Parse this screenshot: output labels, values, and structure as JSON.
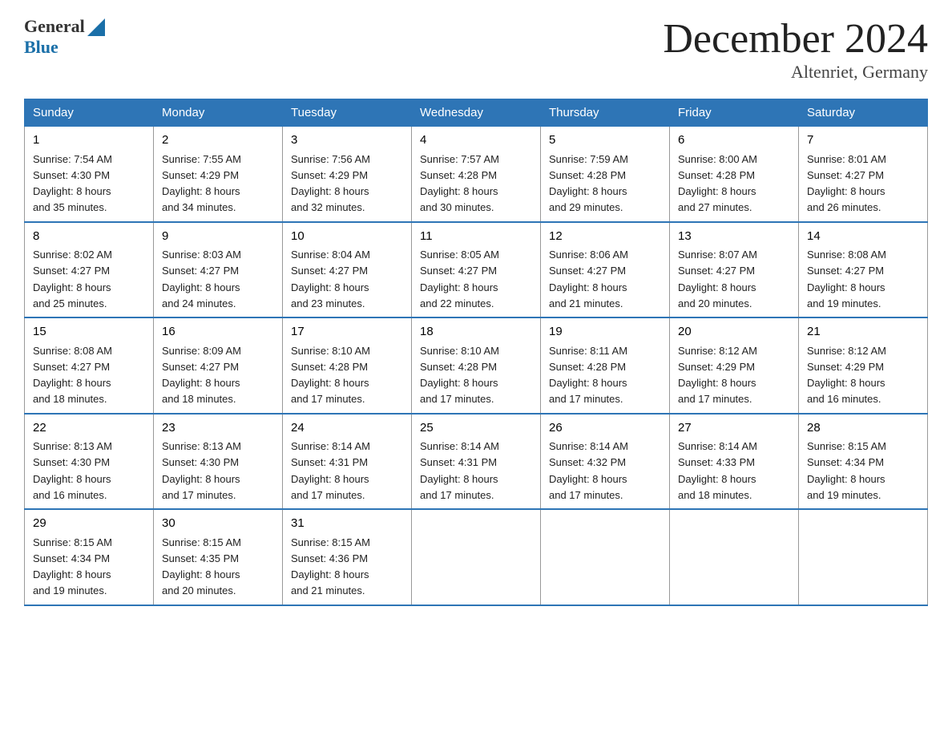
{
  "header": {
    "logo_general": "General",
    "logo_blue": "Blue",
    "month_title": "December 2024",
    "location": "Altenriet, Germany"
  },
  "weekdays": [
    "Sunday",
    "Monday",
    "Tuesday",
    "Wednesday",
    "Thursday",
    "Friday",
    "Saturday"
  ],
  "weeks": [
    [
      {
        "day": "1",
        "sunrise": "7:54 AM",
        "sunset": "4:30 PM",
        "daylight": "8 hours and 35 minutes."
      },
      {
        "day": "2",
        "sunrise": "7:55 AM",
        "sunset": "4:29 PM",
        "daylight": "8 hours and 34 minutes."
      },
      {
        "day": "3",
        "sunrise": "7:56 AM",
        "sunset": "4:29 PM",
        "daylight": "8 hours and 32 minutes."
      },
      {
        "day": "4",
        "sunrise": "7:57 AM",
        "sunset": "4:28 PM",
        "daylight": "8 hours and 30 minutes."
      },
      {
        "day": "5",
        "sunrise": "7:59 AM",
        "sunset": "4:28 PM",
        "daylight": "8 hours and 29 minutes."
      },
      {
        "day": "6",
        "sunrise": "8:00 AM",
        "sunset": "4:28 PM",
        "daylight": "8 hours and 27 minutes."
      },
      {
        "day": "7",
        "sunrise": "8:01 AM",
        "sunset": "4:27 PM",
        "daylight": "8 hours and 26 minutes."
      }
    ],
    [
      {
        "day": "8",
        "sunrise": "8:02 AM",
        "sunset": "4:27 PM",
        "daylight": "8 hours and 25 minutes."
      },
      {
        "day": "9",
        "sunrise": "8:03 AM",
        "sunset": "4:27 PM",
        "daylight": "8 hours and 24 minutes."
      },
      {
        "day": "10",
        "sunrise": "8:04 AM",
        "sunset": "4:27 PM",
        "daylight": "8 hours and 23 minutes."
      },
      {
        "day": "11",
        "sunrise": "8:05 AM",
        "sunset": "4:27 PM",
        "daylight": "8 hours and 22 minutes."
      },
      {
        "day": "12",
        "sunrise": "8:06 AM",
        "sunset": "4:27 PM",
        "daylight": "8 hours and 21 minutes."
      },
      {
        "day": "13",
        "sunrise": "8:07 AM",
        "sunset": "4:27 PM",
        "daylight": "8 hours and 20 minutes."
      },
      {
        "day": "14",
        "sunrise": "8:08 AM",
        "sunset": "4:27 PM",
        "daylight": "8 hours and 19 minutes."
      }
    ],
    [
      {
        "day": "15",
        "sunrise": "8:08 AM",
        "sunset": "4:27 PM",
        "daylight": "8 hours and 18 minutes."
      },
      {
        "day": "16",
        "sunrise": "8:09 AM",
        "sunset": "4:27 PM",
        "daylight": "8 hours and 18 minutes."
      },
      {
        "day": "17",
        "sunrise": "8:10 AM",
        "sunset": "4:28 PM",
        "daylight": "8 hours and 17 minutes."
      },
      {
        "day": "18",
        "sunrise": "8:10 AM",
        "sunset": "4:28 PM",
        "daylight": "8 hours and 17 minutes."
      },
      {
        "day": "19",
        "sunrise": "8:11 AM",
        "sunset": "4:28 PM",
        "daylight": "8 hours and 17 minutes."
      },
      {
        "day": "20",
        "sunrise": "8:12 AM",
        "sunset": "4:29 PM",
        "daylight": "8 hours and 17 minutes."
      },
      {
        "day": "21",
        "sunrise": "8:12 AM",
        "sunset": "4:29 PM",
        "daylight": "8 hours and 16 minutes."
      }
    ],
    [
      {
        "day": "22",
        "sunrise": "8:13 AM",
        "sunset": "4:30 PM",
        "daylight": "8 hours and 16 minutes."
      },
      {
        "day": "23",
        "sunrise": "8:13 AM",
        "sunset": "4:30 PM",
        "daylight": "8 hours and 17 minutes."
      },
      {
        "day": "24",
        "sunrise": "8:14 AM",
        "sunset": "4:31 PM",
        "daylight": "8 hours and 17 minutes."
      },
      {
        "day": "25",
        "sunrise": "8:14 AM",
        "sunset": "4:31 PM",
        "daylight": "8 hours and 17 minutes."
      },
      {
        "day": "26",
        "sunrise": "8:14 AM",
        "sunset": "4:32 PM",
        "daylight": "8 hours and 17 minutes."
      },
      {
        "day": "27",
        "sunrise": "8:14 AM",
        "sunset": "4:33 PM",
        "daylight": "8 hours and 18 minutes."
      },
      {
        "day": "28",
        "sunrise": "8:15 AM",
        "sunset": "4:34 PM",
        "daylight": "8 hours and 19 minutes."
      }
    ],
    [
      {
        "day": "29",
        "sunrise": "8:15 AM",
        "sunset": "4:34 PM",
        "daylight": "8 hours and 19 minutes."
      },
      {
        "day": "30",
        "sunrise": "8:15 AM",
        "sunset": "4:35 PM",
        "daylight": "8 hours and 20 minutes."
      },
      {
        "day": "31",
        "sunrise": "8:15 AM",
        "sunset": "4:36 PM",
        "daylight": "8 hours and 21 minutes."
      },
      null,
      null,
      null,
      null
    ]
  ],
  "labels": {
    "sunrise": "Sunrise:",
    "sunset": "Sunset:",
    "daylight": "Daylight:"
  }
}
